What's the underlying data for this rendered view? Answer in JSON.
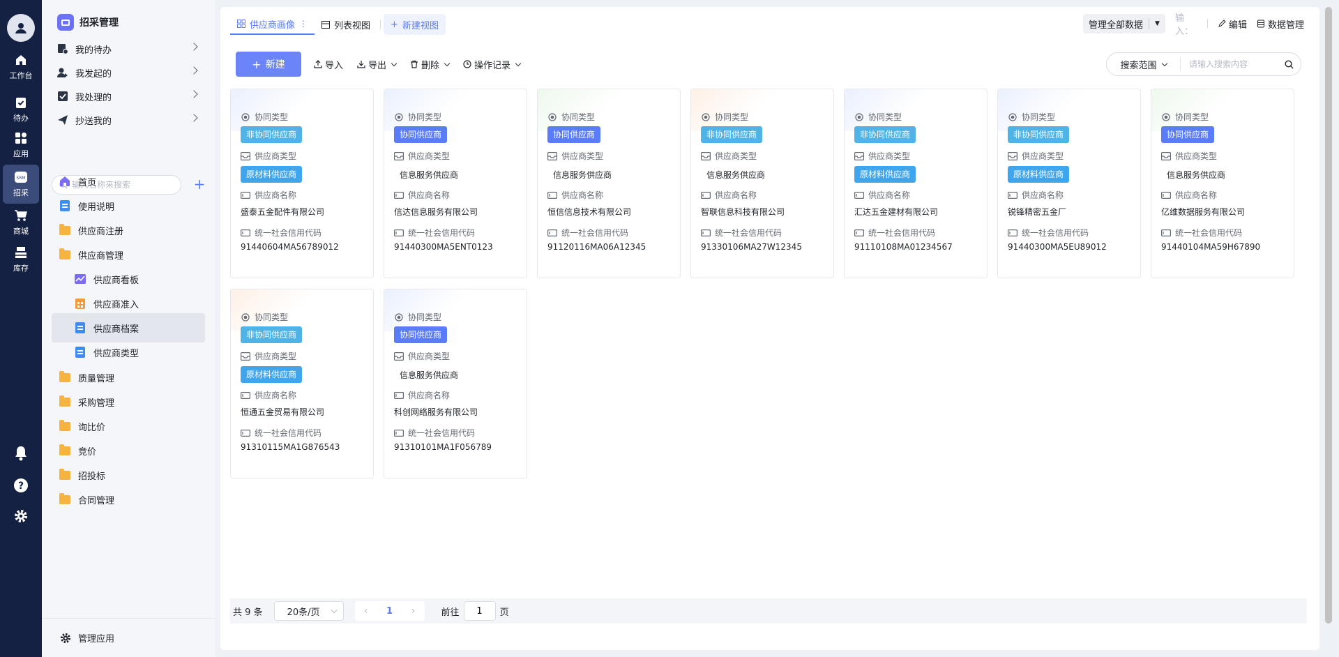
{
  "rail": {
    "items": [
      {
        "label": "工作台",
        "icon": "home-icon"
      },
      {
        "label": "待办",
        "icon": "clipboard-check-icon"
      },
      {
        "label": "应用",
        "icon": "apps-grid-icon"
      },
      {
        "label": "招采",
        "icon": "procurement-icon"
      },
      {
        "label": "商城",
        "icon": "cart-icon"
      },
      {
        "label": "库存",
        "icon": "inventory-icon"
      }
    ],
    "active_index": 3
  },
  "sidebar": {
    "title": "招采管理",
    "tasks": [
      {
        "label": "我的待办",
        "icon": "todo-clock-icon"
      },
      {
        "label": "我发起的",
        "icon": "user-send-icon"
      },
      {
        "label": "我处理的",
        "icon": "check-box-icon"
      },
      {
        "label": "抄送我的",
        "icon": "paper-plane-icon"
      }
    ],
    "search_placeholder": "输入名称来搜索",
    "nav": [
      {
        "label": "首页",
        "icon": "home-purple-icon",
        "level": 0
      },
      {
        "label": "使用说明",
        "icon": "document-icon",
        "level": 0
      },
      {
        "label": "供应商注册",
        "icon": "folder-icon",
        "level": 0
      },
      {
        "label": "供应商管理",
        "icon": "folder-open-icon",
        "level": 0
      },
      {
        "label": "供应商看板",
        "icon": "dashboard-chart-icon",
        "level": 1
      },
      {
        "label": "供应商准入",
        "icon": "calendar-grid-icon",
        "level": 1
      },
      {
        "label": "供应商档案",
        "icon": "document-icon",
        "level": 1,
        "active": true
      },
      {
        "label": "供应商类型",
        "icon": "document-icon",
        "level": 1
      },
      {
        "label": "质量管理",
        "icon": "folder-icon",
        "level": 0
      },
      {
        "label": "采购管理",
        "icon": "folder-icon",
        "level": 0
      },
      {
        "label": "询比价",
        "icon": "folder-icon",
        "level": 0
      },
      {
        "label": "竞价",
        "icon": "folder-icon",
        "level": 0
      },
      {
        "label": "招投标",
        "icon": "folder-icon",
        "level": 0
      },
      {
        "label": "合同管理",
        "icon": "folder-icon",
        "level": 0
      }
    ],
    "footer": "管理应用"
  },
  "tabs": {
    "items": [
      "供应商画像",
      "列表视图"
    ],
    "new_view": "新建视图"
  },
  "topright": {
    "manage_all": "管理全部数据",
    "input_label": "输入：",
    "edit": "编辑",
    "data_manage": "数据管理"
  },
  "toolbar": {
    "new": "新建",
    "import": "导入",
    "export": "导出",
    "delete": "删除",
    "log": "操作记录"
  },
  "search": {
    "scope": "搜索范围",
    "placeholder": "请输入搜索内容"
  },
  "field_labels": {
    "coop_type": "协同类型",
    "supplier_type": "供应商类型",
    "supplier_name": "供应商名称",
    "credit_code": "统一社会信用代码"
  },
  "colors": {
    "non_coop": "#4fb3e5",
    "coop": "#5b7cf7",
    "raw_material": "#3fa6ee",
    "accent": "#5b7cf7"
  },
  "cards": [
    {
      "coop_type": "非协同供应商",
      "supplier_type": "原材料供应商",
      "supplier_type_tag": true,
      "name": "盛泰五金配件有限公司",
      "code": "91440604MA56789012"
    },
    {
      "coop_type": "协同供应商",
      "supplier_type": "信息服务供应商",
      "supplier_type_tag": false,
      "name": "信达信息服务有限公司",
      "code": "91440300MA5ENT0123"
    },
    {
      "coop_type": "协同供应商",
      "supplier_type": "信息服务供应商",
      "supplier_type_tag": false,
      "name": "恒信信息技术有限公司",
      "code": "91120116MA06A12345"
    },
    {
      "coop_type": "非协同供应商",
      "supplier_type": "信息服务供应商",
      "supplier_type_tag": false,
      "name": "智联信息科技有限公司",
      "code": "91330106MA27W12345"
    },
    {
      "coop_type": "非协同供应商",
      "supplier_type": "原材料供应商",
      "supplier_type_tag": true,
      "name": "汇达五金建材有限公司",
      "code": "91110108MA01234567"
    },
    {
      "coop_type": "非协同供应商",
      "supplier_type": "原材料供应商",
      "supplier_type_tag": true,
      "name": "锐锋精密五金厂",
      "code": "91440300MA5EU89012"
    },
    {
      "coop_type": "协同供应商",
      "supplier_type": "信息服务供应商",
      "supplier_type_tag": false,
      "name": "亿维数据服务有限公司",
      "code": "91440104MA59H67890"
    },
    {
      "coop_type": "非协同供应商",
      "supplier_type": "原材料供应商",
      "supplier_type_tag": true,
      "name": "恒通五金贸易有限公司",
      "code": "91310115MA1G876543"
    },
    {
      "coop_type": "协同供应商",
      "supplier_type": "信息服务供应商",
      "supplier_type_tag": false,
      "name": "科创网络服务有限公司",
      "code": "91310101MA1F056789"
    }
  ],
  "pager": {
    "total": "共 9 条",
    "page_size": "20条/页",
    "current_page": "1",
    "goto_label": "前往",
    "goto_value": "1",
    "page_suffix": "页"
  }
}
